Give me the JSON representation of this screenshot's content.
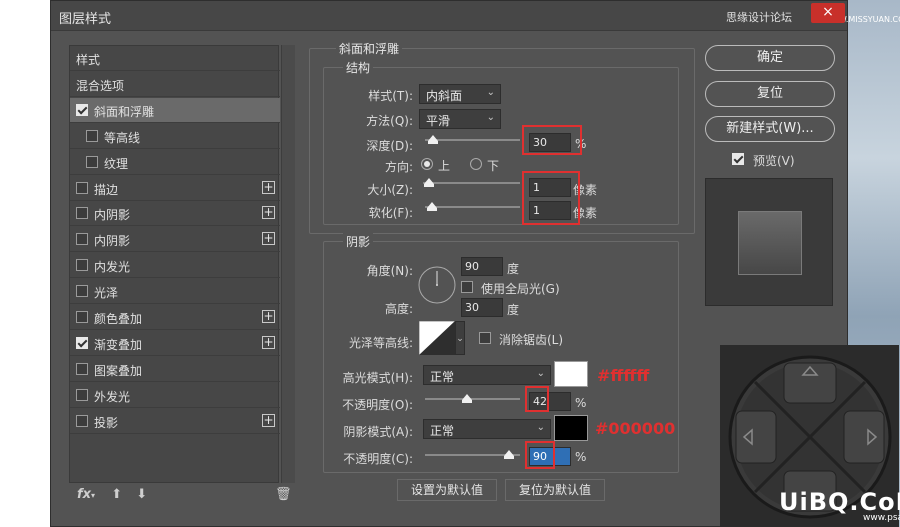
{
  "window": {
    "title": "图层样式",
    "close_icon": "×",
    "watermark": "思缘设计论坛",
    "watermark_url": "WWW.MISSYUAN.COM"
  },
  "sidebar": {
    "items": [
      {
        "label": "样式",
        "checkbox": false,
        "checked": false,
        "plus": false,
        "indent": false
      },
      {
        "label": "混合选项",
        "checkbox": false,
        "checked": false,
        "plus": false,
        "indent": false
      },
      {
        "label": "斜面和浮雕",
        "checkbox": true,
        "checked": true,
        "plus": false,
        "indent": false,
        "selected": true
      },
      {
        "label": "等高线",
        "checkbox": true,
        "checked": false,
        "plus": false,
        "indent": true
      },
      {
        "label": "纹理",
        "checkbox": true,
        "checked": false,
        "plus": false,
        "indent": true
      },
      {
        "label": "描边",
        "checkbox": true,
        "checked": false,
        "plus": true,
        "indent": false
      },
      {
        "label": "内阴影",
        "checkbox": true,
        "checked": false,
        "plus": true,
        "indent": false
      },
      {
        "label": "内阴影",
        "checkbox": true,
        "checked": false,
        "plus": true,
        "indent": false
      },
      {
        "label": "内发光",
        "checkbox": true,
        "checked": false,
        "plus": false,
        "indent": false
      },
      {
        "label": "光泽",
        "checkbox": true,
        "checked": false,
        "plus": false,
        "indent": false
      },
      {
        "label": "颜色叠加",
        "checkbox": true,
        "checked": false,
        "plus": true,
        "indent": false
      },
      {
        "label": "渐变叠加",
        "checkbox": true,
        "checked": true,
        "plus": true,
        "indent": false
      },
      {
        "label": "图案叠加",
        "checkbox": true,
        "checked": false,
        "plus": false,
        "indent": false
      },
      {
        "label": "外发光",
        "checkbox": true,
        "checked": false,
        "plus": false,
        "indent": false
      },
      {
        "label": "投影",
        "checkbox": true,
        "checked": false,
        "plus": true,
        "indent": false
      }
    ],
    "fx_label": "fx"
  },
  "bevel": {
    "section_title": "斜面和浮雕",
    "structure_title": "结构",
    "style_label": "样式(T):",
    "style_value": "内斜面",
    "technique_label": "方法(Q):",
    "technique_value": "平滑",
    "depth_label": "深度(D):",
    "depth_value": "30",
    "depth_unit": "%",
    "depth_level": 0.03,
    "direction_label": "方向:",
    "dir_up": "上",
    "dir_down": "下",
    "size_label": "大小(Z):",
    "size_value": "1",
    "size_unit": "像素",
    "size_level": 0.01,
    "soften_label": "软化(F):",
    "soften_value": "1",
    "soften_unit": "像素",
    "soften_level": 0.02
  },
  "shading": {
    "section_title": "阴影",
    "angle_label": "角度(N):",
    "angle_value": "90",
    "angle_unit": "度",
    "global_light_label": "使用全局光(G)",
    "altitude_label": "高度:",
    "altitude_value": "30",
    "altitude_unit": "度",
    "gloss_label": "光泽等高线:",
    "antialias_label": "消除锯齿(L)",
    "highlight_mode_label": "高光模式(H):",
    "highlight_mode_value": "正常",
    "highlight_color": "#ffffff",
    "highlight_note": "#ffffff",
    "highlight_opacity_label": "不透明度(O):",
    "highlight_opacity_value": "42",
    "highlight_opacity_unit": "%",
    "highlight_opacity_level": 0.42,
    "shadow_mode_label": "阴影模式(A):",
    "shadow_mode_value": "正常",
    "shadow_color": "#000000",
    "shadow_note": "#000000",
    "shadow_opacity_label": "不透明度(C):",
    "shadow_opacity_value": "90",
    "shadow_opacity_unit": "%",
    "shadow_opacity_level": 0.9
  },
  "buttons": {
    "ok": "确定",
    "reset": "复位",
    "new_style": "新建样式(W)...",
    "preview": "预览(V)",
    "make_default": "设置为默认值",
    "reset_default": "复位为默认值"
  },
  "watermark": {
    "brand": "UiBQ.CoM",
    "url": "www.psanz.com"
  }
}
